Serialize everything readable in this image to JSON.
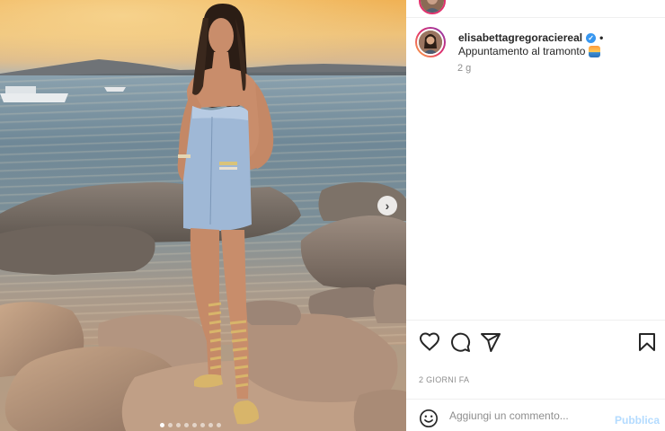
{
  "post": {
    "username": "elisabettagregoraciereal",
    "verified_icon": "verified-badge-icon",
    "bullet": "•",
    "caption": "Appuntamento al tramonto",
    "caption_emoji": "sunset-emoji",
    "time_short": "2 g",
    "date_label": "2 GIORNI FA"
  },
  "carousel": {
    "total_dots": 8,
    "active_dot": 1,
    "next_icon": "chevron-right-icon"
  },
  "actions": {
    "like_icon": "heart-icon",
    "comment_icon": "comment-icon",
    "share_icon": "share-icon",
    "save_icon": "bookmark-icon"
  },
  "comment": {
    "placeholder": "Aggiungi un commento...",
    "publish_label": "Pubblica",
    "emoji_icon": "smiley-icon"
  },
  "colors": {
    "accent_blue": "#3897f0",
    "publish_disabled": "#b3dbff",
    "story_ring": "#e1306c"
  }
}
